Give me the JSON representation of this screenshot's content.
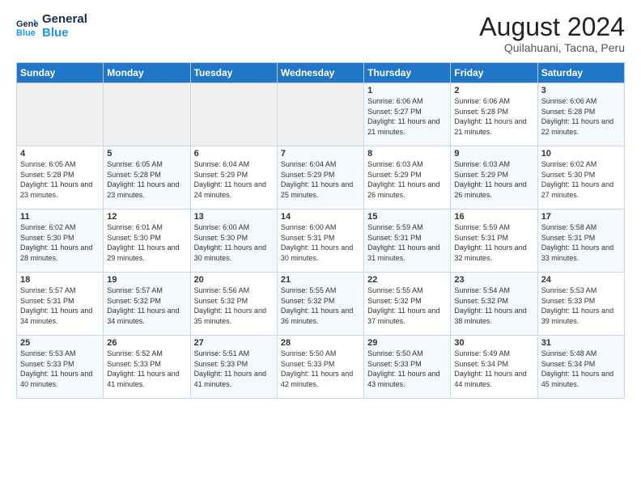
{
  "header": {
    "logo_general": "General",
    "logo_blue": "Blue",
    "month_year": "August 2024",
    "location": "Quilahuani, Tacna, Peru"
  },
  "days_of_week": [
    "Sunday",
    "Monday",
    "Tuesday",
    "Wednesday",
    "Thursday",
    "Friday",
    "Saturday"
  ],
  "weeks": [
    [
      {
        "day": "",
        "sunrise": "",
        "sunset": "",
        "daylight": ""
      },
      {
        "day": "",
        "sunrise": "",
        "sunset": "",
        "daylight": ""
      },
      {
        "day": "",
        "sunrise": "",
        "sunset": "",
        "daylight": ""
      },
      {
        "day": "",
        "sunrise": "",
        "sunset": "",
        "daylight": ""
      },
      {
        "day": "1",
        "sunrise": "Sunrise: 6:06 AM",
        "sunset": "Sunset: 5:27 PM",
        "daylight": "Daylight: 11 hours and 21 minutes."
      },
      {
        "day": "2",
        "sunrise": "Sunrise: 6:06 AM",
        "sunset": "Sunset: 5:28 PM",
        "daylight": "Daylight: 11 hours and 21 minutes."
      },
      {
        "day": "3",
        "sunrise": "Sunrise: 6:06 AM",
        "sunset": "Sunset: 5:28 PM",
        "daylight": "Daylight: 11 hours and 22 minutes."
      }
    ],
    [
      {
        "day": "4",
        "sunrise": "Sunrise: 6:05 AM",
        "sunset": "Sunset: 5:28 PM",
        "daylight": "Daylight: 11 hours and 23 minutes."
      },
      {
        "day": "5",
        "sunrise": "Sunrise: 6:05 AM",
        "sunset": "Sunset: 5:28 PM",
        "daylight": "Daylight: 11 hours and 23 minutes."
      },
      {
        "day": "6",
        "sunrise": "Sunrise: 6:04 AM",
        "sunset": "Sunset: 5:29 PM",
        "daylight": "Daylight: 11 hours and 24 minutes."
      },
      {
        "day": "7",
        "sunrise": "Sunrise: 6:04 AM",
        "sunset": "Sunset: 5:29 PM",
        "daylight": "Daylight: 11 hours and 25 minutes."
      },
      {
        "day": "8",
        "sunrise": "Sunrise: 6:03 AM",
        "sunset": "Sunset: 5:29 PM",
        "daylight": "Daylight: 11 hours and 26 minutes."
      },
      {
        "day": "9",
        "sunrise": "Sunrise: 6:03 AM",
        "sunset": "Sunset: 5:29 PM",
        "daylight": "Daylight: 11 hours and 26 minutes."
      },
      {
        "day": "10",
        "sunrise": "Sunrise: 6:02 AM",
        "sunset": "Sunset: 5:30 PM",
        "daylight": "Daylight: 11 hours and 27 minutes."
      }
    ],
    [
      {
        "day": "11",
        "sunrise": "Sunrise: 6:02 AM",
        "sunset": "Sunset: 5:30 PM",
        "daylight": "Daylight: 11 hours and 28 minutes."
      },
      {
        "day": "12",
        "sunrise": "Sunrise: 6:01 AM",
        "sunset": "Sunset: 5:30 PM",
        "daylight": "Daylight: 11 hours and 29 minutes."
      },
      {
        "day": "13",
        "sunrise": "Sunrise: 6:00 AM",
        "sunset": "Sunset: 5:30 PM",
        "daylight": "Daylight: 11 hours and 30 minutes."
      },
      {
        "day": "14",
        "sunrise": "Sunrise: 6:00 AM",
        "sunset": "Sunset: 5:31 PM",
        "daylight": "Daylight: 11 hours and 30 minutes."
      },
      {
        "day": "15",
        "sunrise": "Sunrise: 5:59 AM",
        "sunset": "Sunset: 5:31 PM",
        "daylight": "Daylight: 11 hours and 31 minutes."
      },
      {
        "day": "16",
        "sunrise": "Sunrise: 5:59 AM",
        "sunset": "Sunset: 5:31 PM",
        "daylight": "Daylight: 11 hours and 32 minutes."
      },
      {
        "day": "17",
        "sunrise": "Sunrise: 5:58 AM",
        "sunset": "Sunset: 5:31 PM",
        "daylight": "Daylight: 11 hours and 33 minutes."
      }
    ],
    [
      {
        "day": "18",
        "sunrise": "Sunrise: 5:57 AM",
        "sunset": "Sunset: 5:31 PM",
        "daylight": "Daylight: 11 hours and 34 minutes."
      },
      {
        "day": "19",
        "sunrise": "Sunrise: 5:57 AM",
        "sunset": "Sunset: 5:32 PM",
        "daylight": "Daylight: 11 hours and 34 minutes."
      },
      {
        "day": "20",
        "sunrise": "Sunrise: 5:56 AM",
        "sunset": "Sunset: 5:32 PM",
        "daylight": "Daylight: 11 hours and 35 minutes."
      },
      {
        "day": "21",
        "sunrise": "Sunrise: 5:55 AM",
        "sunset": "Sunset: 5:32 PM",
        "daylight": "Daylight: 11 hours and 36 minutes."
      },
      {
        "day": "22",
        "sunrise": "Sunrise: 5:55 AM",
        "sunset": "Sunset: 5:32 PM",
        "daylight": "Daylight: 11 hours and 37 minutes."
      },
      {
        "day": "23",
        "sunrise": "Sunrise: 5:54 AM",
        "sunset": "Sunset: 5:32 PM",
        "daylight": "Daylight: 11 hours and 38 minutes."
      },
      {
        "day": "24",
        "sunrise": "Sunrise: 5:53 AM",
        "sunset": "Sunset: 5:33 PM",
        "daylight": "Daylight: 11 hours and 39 minutes."
      }
    ],
    [
      {
        "day": "25",
        "sunrise": "Sunrise: 5:53 AM",
        "sunset": "Sunset: 5:33 PM",
        "daylight": "Daylight: 11 hours and 40 minutes."
      },
      {
        "day": "26",
        "sunrise": "Sunrise: 5:52 AM",
        "sunset": "Sunset: 5:33 PM",
        "daylight": "Daylight: 11 hours and 41 minutes."
      },
      {
        "day": "27",
        "sunrise": "Sunrise: 5:51 AM",
        "sunset": "Sunset: 5:33 PM",
        "daylight": "Daylight: 11 hours and 41 minutes."
      },
      {
        "day": "28",
        "sunrise": "Sunrise: 5:50 AM",
        "sunset": "Sunset: 5:33 PM",
        "daylight": "Daylight: 11 hours and 42 minutes."
      },
      {
        "day": "29",
        "sunrise": "Sunrise: 5:50 AM",
        "sunset": "Sunset: 5:33 PM",
        "daylight": "Daylight: 11 hours and 43 minutes."
      },
      {
        "day": "30",
        "sunrise": "Sunrise: 5:49 AM",
        "sunset": "Sunset: 5:34 PM",
        "daylight": "Daylight: 11 hours and 44 minutes."
      },
      {
        "day": "31",
        "sunrise": "Sunrise: 5:48 AM",
        "sunset": "Sunset: 5:34 PM",
        "daylight": "Daylight: 11 hours and 45 minutes."
      }
    ]
  ]
}
